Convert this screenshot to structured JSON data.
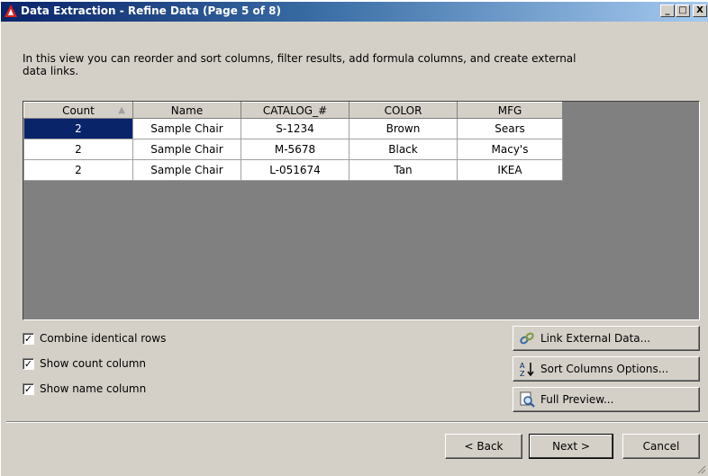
{
  "window": {
    "title": "Data Extraction - Refine Data (Page 5 of 8)",
    "controls": {
      "minimize": "_",
      "maximize": "□",
      "close": "X"
    }
  },
  "description": "In this view you can reorder and sort columns, filter results, add formula columns, and create external data links.",
  "table": {
    "columns": [
      "Count",
      "Name",
      "CATALOG_#",
      "COLOR",
      "MFG"
    ],
    "sort_indicator": "▲",
    "rows": [
      [
        "2",
        "Sample Chair",
        "S-1234",
        "Brown",
        "Sears"
      ],
      [
        "2",
        "Sample Chair",
        "M-5678",
        "Black",
        "Macy's"
      ],
      [
        "2",
        "Sample Chair",
        "L-051674",
        "Tan",
        "IKEA"
      ]
    ]
  },
  "options": [
    {
      "label": "Combine identical rows",
      "checked": true
    },
    {
      "label": "Show count column",
      "checked": true
    },
    {
      "label": "Show name column",
      "checked": true
    }
  ],
  "side_buttons": {
    "link_external": {
      "label": "Link External Data...",
      "icon": "link-icon"
    },
    "sort_columns": {
      "label": "Sort Columns Options...",
      "icon": "sort-az-icon"
    },
    "full_preview": {
      "label": "Full Preview...",
      "icon": "preview-icon"
    }
  },
  "footer": {
    "back": "< Back",
    "next": "Next >",
    "cancel": "Cancel"
  },
  "colors": {
    "accent": "#0a246a",
    "face": "#d4d0c8",
    "grid_bg": "#808080"
  }
}
